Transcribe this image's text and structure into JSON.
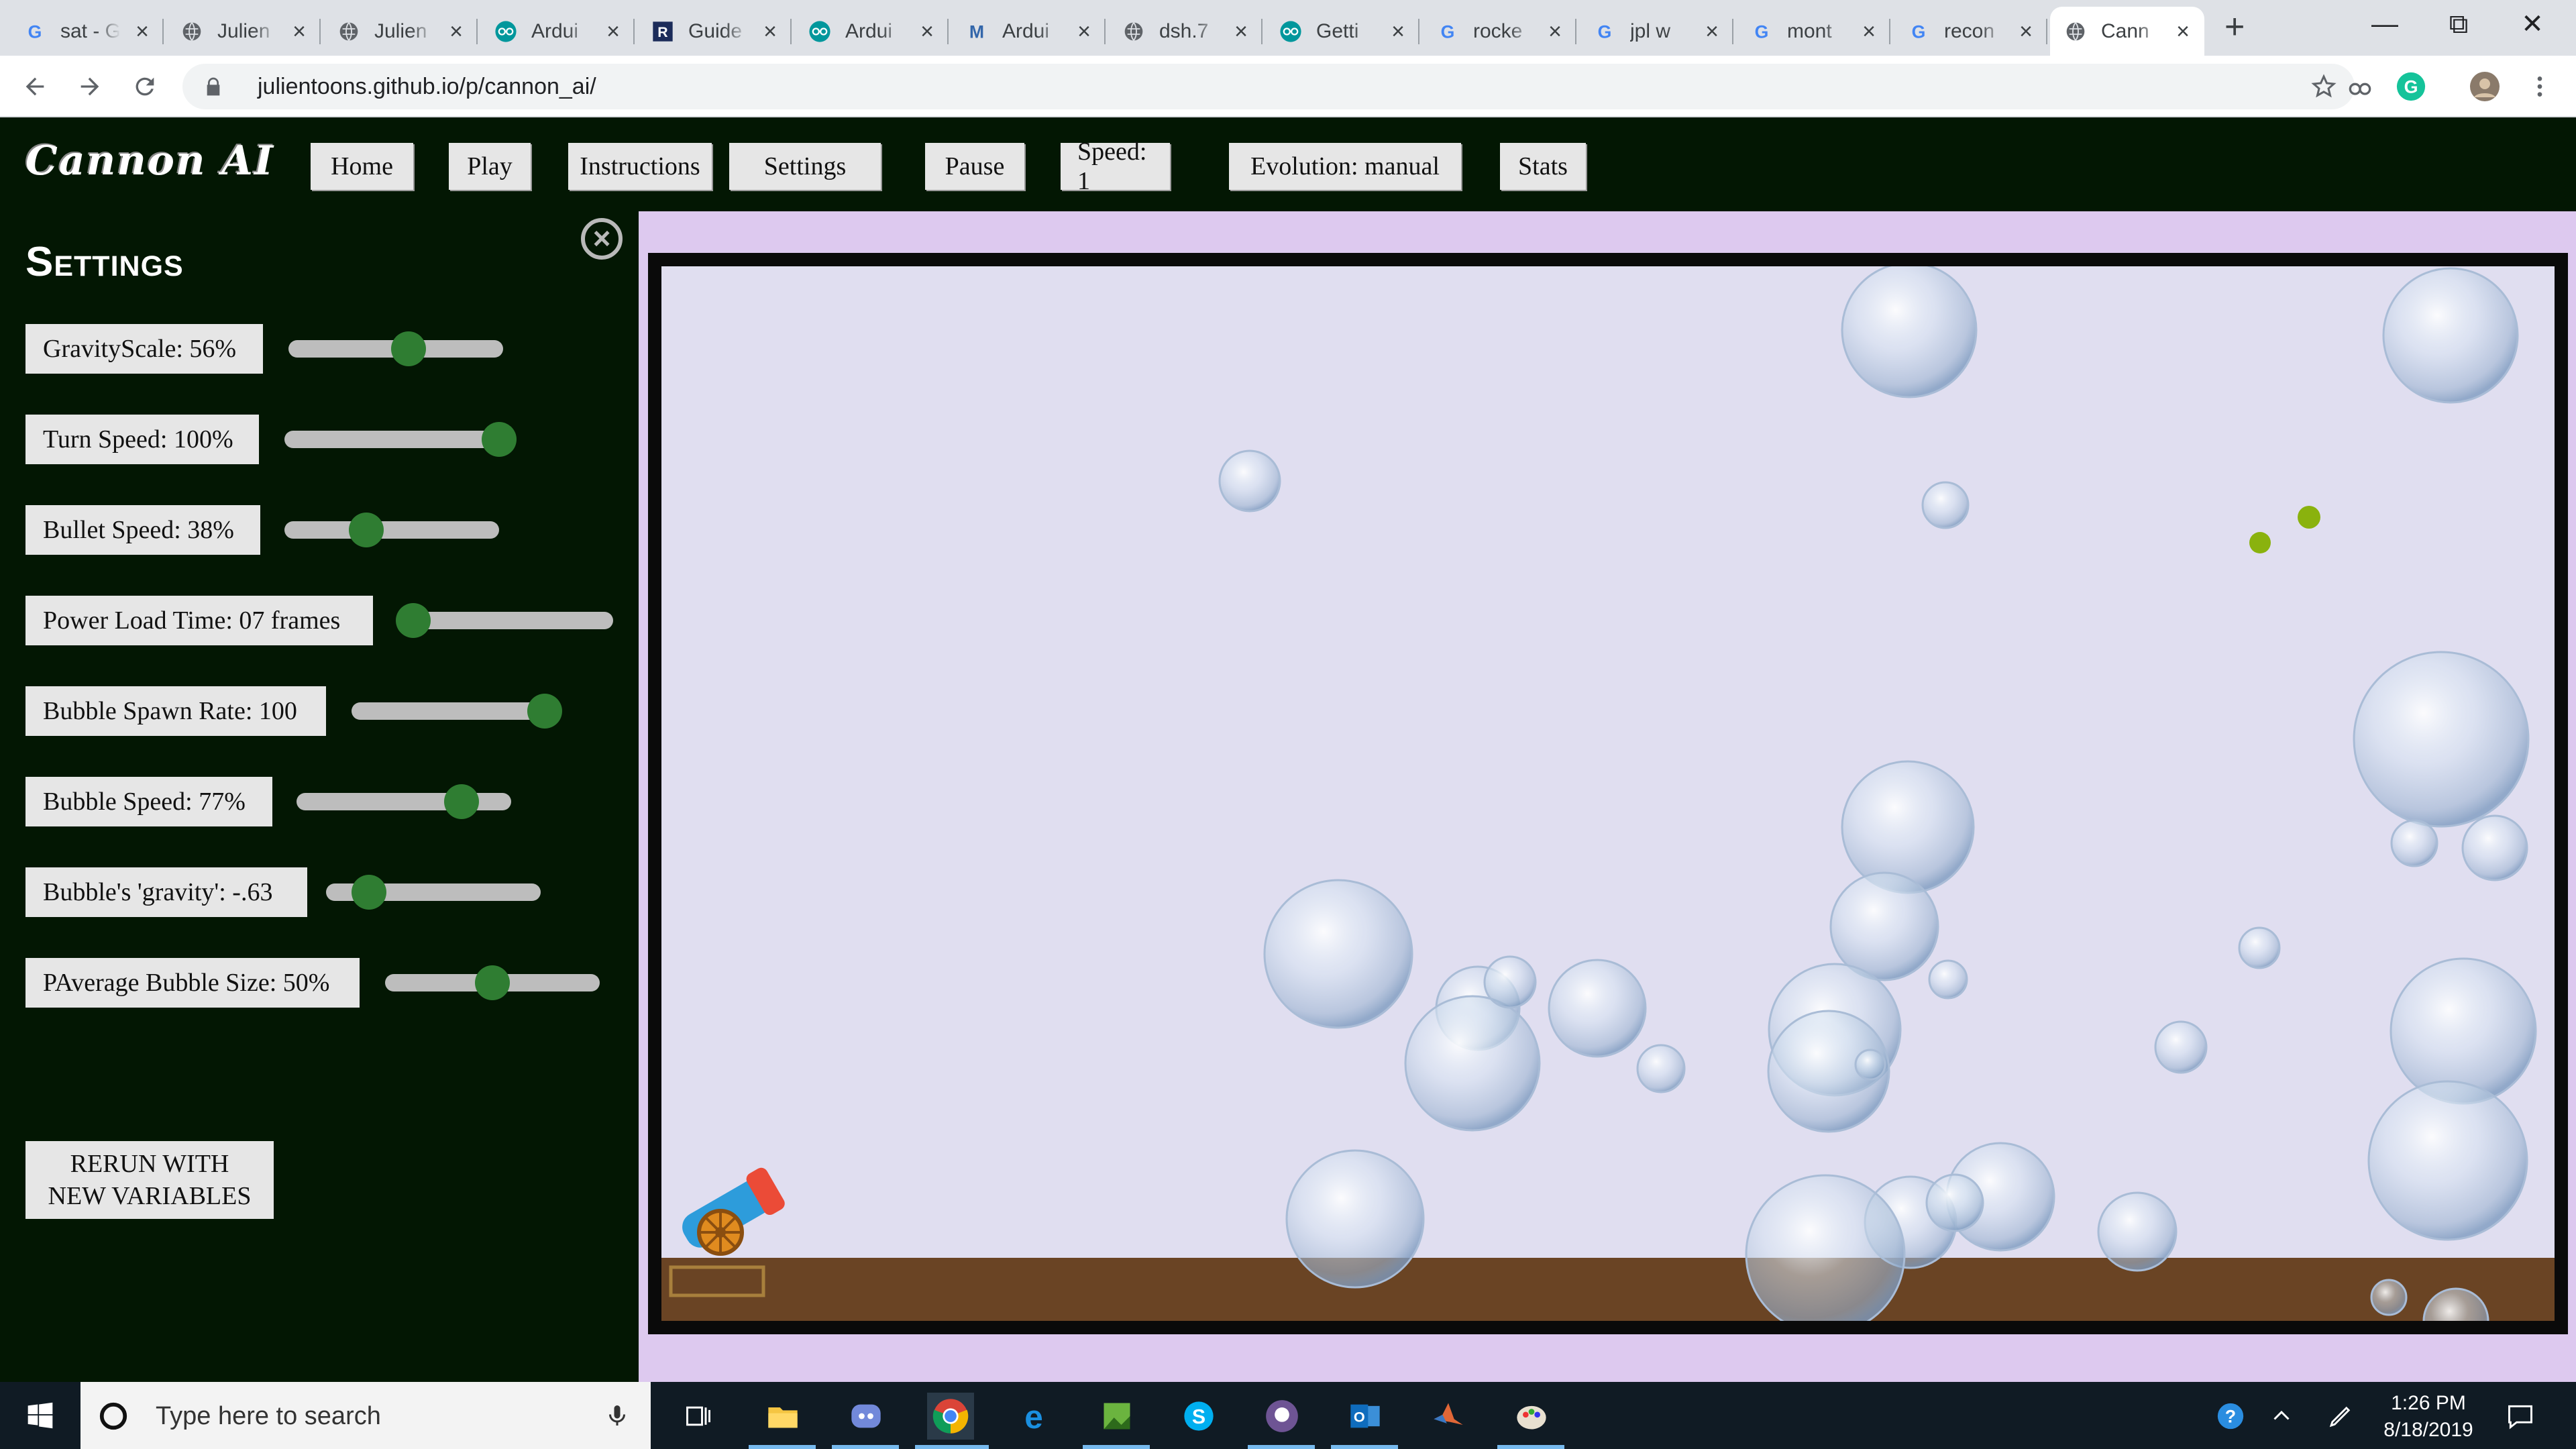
{
  "browser": {
    "tabs": [
      {
        "title": "sat - G",
        "icon": "google-icon"
      },
      {
        "title": "Julien",
        "icon": "globe-icon"
      },
      {
        "title": "Julien",
        "icon": "globe-icon"
      },
      {
        "title": "Ardui",
        "icon": "arduino-icon"
      },
      {
        "title": "Guide",
        "icon": "r-icon"
      },
      {
        "title": "Ardui",
        "icon": "arduino-icon"
      },
      {
        "title": "Ardui",
        "icon": "m-icon"
      },
      {
        "title": "dsh.7",
        "icon": "globe-icon"
      },
      {
        "title": "Getti",
        "icon": "arduino-icon"
      },
      {
        "title": "rocke",
        "icon": "google-icon"
      },
      {
        "title": "jpl w",
        "icon": "google-icon"
      },
      {
        "title": "mont",
        "icon": "google-icon"
      },
      {
        "title": "recon",
        "icon": "google-icon"
      },
      {
        "title": "Cann",
        "icon": "globe-icon",
        "active": true
      }
    ],
    "url": "julientoons.github.io/p/cannon_ai/"
  },
  "app": {
    "logo": "Cannon AI",
    "nav": [
      "Home",
      "Play",
      "Instructions",
      "Settings",
      "Pause",
      "Speed: 1",
      "Evolution: manual",
      "Stats"
    ]
  },
  "settings": {
    "title": "Settings",
    "items": [
      {
        "label": "GravityScale: 56%",
        "value": 0.56
      },
      {
        "label": "Turn Speed: 100%",
        "value": 1.0
      },
      {
        "label": "Bullet Speed: 38%",
        "value": 0.38
      },
      {
        "label": "Power Load Time: 07 frames",
        "value": 0.07
      },
      {
        "label": "Bubble Spawn Rate: 100",
        "value": 0.96
      },
      {
        "label": "Bubble Speed: 77%",
        "value": 0.77
      },
      {
        "label": "Bubble's 'gravity': -.63",
        "value": 0.2
      },
      {
        "label": "PAverage Bubble Size: 50%",
        "value": 0.5
      }
    ],
    "rerun_label": "RERUN WITH\nNEW VARIABLES"
  },
  "taskbar": {
    "search_placeholder": "Type here to search",
    "time": "1:26 PM",
    "date": "8/18/2019"
  },
  "colors": {
    "page_bg": "#031703",
    "game_bg": "#e0def0",
    "ground": "#6a4424",
    "slider_thumb": "#2f7d32",
    "frame_border": "#ddc9ef"
  }
}
